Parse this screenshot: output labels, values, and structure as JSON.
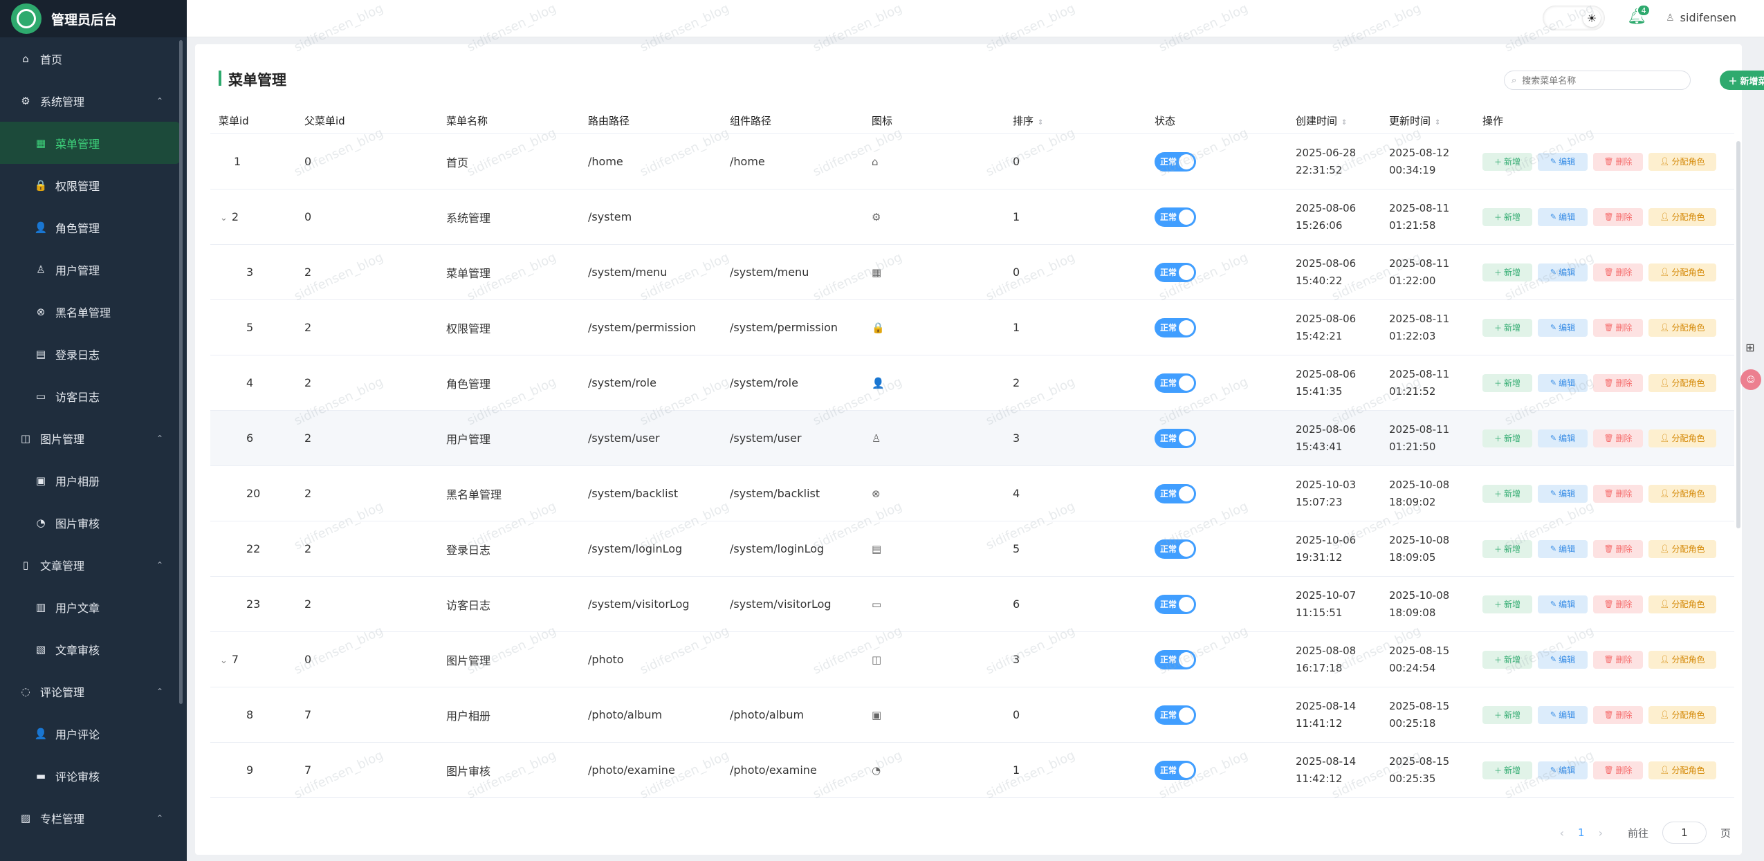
{
  "app": {
    "title": "管理员后台"
  },
  "sidebar": {
    "items": [
      {
        "label": "首页",
        "icon": "home-icon",
        "glyph": "⌂",
        "level": "top",
        "active": false,
        "caret": ""
      },
      {
        "label": "系统管理",
        "icon": "gear-icon",
        "glyph": "⚙",
        "level": "top",
        "active": false,
        "caret": "⌃"
      },
      {
        "label": "菜单管理",
        "icon": "grid-icon",
        "glyph": "▦",
        "level": "sub",
        "active": true,
        "caret": ""
      },
      {
        "label": "权限管理",
        "icon": "lock-icon",
        "glyph": "🔒",
        "level": "sub",
        "active": false,
        "caret": ""
      },
      {
        "label": "角色管理",
        "icon": "user-filled-icon",
        "glyph": "👤",
        "level": "sub",
        "active": false,
        "caret": ""
      },
      {
        "label": "用户管理",
        "icon": "user-icon",
        "glyph": "♙",
        "level": "sub",
        "active": false,
        "caret": ""
      },
      {
        "label": "黑名单管理",
        "icon": "circle-x-icon",
        "glyph": "⊗",
        "level": "sub",
        "active": false,
        "caret": ""
      },
      {
        "label": "登录日志",
        "icon": "calendar-icon",
        "glyph": "▤",
        "level": "sub",
        "active": false,
        "caret": ""
      },
      {
        "label": "访客日志",
        "icon": "monitor-icon",
        "glyph": "▭",
        "level": "sub",
        "active": false,
        "caret": ""
      },
      {
        "label": "图片管理",
        "icon": "camera-icon",
        "glyph": "◫",
        "level": "top",
        "active": false,
        "caret": "⌃"
      },
      {
        "label": "用户相册",
        "icon": "picture-icon",
        "glyph": "▣",
        "level": "sub",
        "active": false,
        "caret": ""
      },
      {
        "label": "图片审核",
        "icon": "check-circle-icon",
        "glyph": "◔",
        "level": "sub",
        "active": false,
        "caret": ""
      },
      {
        "label": "文章管理",
        "icon": "document-icon",
        "glyph": "▯",
        "level": "top",
        "active": false,
        "caret": "⌃"
      },
      {
        "label": "用户文章",
        "icon": "documents-icon",
        "glyph": "▥",
        "level": "sub",
        "active": false,
        "caret": ""
      },
      {
        "label": "文章审核",
        "icon": "document-check-icon",
        "glyph": "▧",
        "level": "sub",
        "active": false,
        "caret": ""
      },
      {
        "label": "评论管理",
        "icon": "chat-icon",
        "glyph": "◌",
        "level": "top",
        "active": false,
        "caret": "⌃"
      },
      {
        "label": "用户评论",
        "icon": "user-filled-icon",
        "glyph": "👤",
        "level": "sub",
        "active": false,
        "caret": ""
      },
      {
        "label": "评论审核",
        "icon": "message-icon",
        "glyph": "▬",
        "level": "sub",
        "active": false,
        "caret": ""
      },
      {
        "label": "专栏管理",
        "icon": "notebook-icon",
        "glyph": "▨",
        "level": "top",
        "active": false,
        "caret": "⌃"
      }
    ]
  },
  "header": {
    "notifications": "4",
    "username": "sidifensen"
  },
  "page": {
    "title": "菜单管理",
    "search_placeholder": "搜索菜单名称",
    "add_label": "新增菜单"
  },
  "table": {
    "headers": [
      "菜单id",
      "父菜单id",
      "菜单名称",
      "路由路径",
      "组件路径",
      "图标",
      "排序",
      "状态",
      "创建时间",
      "更新时间",
      "操作"
    ],
    "status_label": "正常",
    "actions": {
      "add": "新增",
      "edit": "编辑",
      "del": "删除",
      "role": "分配角色"
    },
    "rows": [
      {
        "id": "1",
        "pid": "0",
        "name": "首页",
        "path": "/home",
        "comp": "/home",
        "icon": "⌂",
        "sort": "0",
        "created": [
          "2025-06-28",
          "22:31:52"
        ],
        "updated": [
          "2025-08-12",
          "00:34:19"
        ],
        "expand": false,
        "child": false
      },
      {
        "id": "2",
        "pid": "0",
        "name": "系统管理",
        "path": "/system",
        "comp": "",
        "icon": "⚙",
        "sort": "1",
        "created": [
          "2025-08-06",
          "15:26:06"
        ],
        "updated": [
          "2025-08-11",
          "01:21:58"
        ],
        "expand": true,
        "child": false
      },
      {
        "id": "3",
        "pid": "2",
        "name": "菜单管理",
        "path": "/system/menu",
        "comp": "/system/menu",
        "icon": "▦",
        "sort": "0",
        "created": [
          "2025-08-06",
          "15:40:22"
        ],
        "updated": [
          "2025-08-11",
          "01:22:00"
        ],
        "expand": false,
        "child": true
      },
      {
        "id": "5",
        "pid": "2",
        "name": "权限管理",
        "path": "/system/permission",
        "comp": "/system/permission",
        "icon": "🔒",
        "sort": "1",
        "created": [
          "2025-08-06",
          "15:42:21"
        ],
        "updated": [
          "2025-08-11",
          "01:22:03"
        ],
        "expand": false,
        "child": true
      },
      {
        "id": "4",
        "pid": "2",
        "name": "角色管理",
        "path": "/system/role",
        "comp": "/system/role",
        "icon": "👤",
        "sort": "2",
        "created": [
          "2025-08-06",
          "15:41:35"
        ],
        "updated": [
          "2025-08-11",
          "01:21:52"
        ],
        "expand": false,
        "child": true
      },
      {
        "id": "6",
        "pid": "2",
        "name": "用户管理",
        "path": "/system/user",
        "comp": "/system/user",
        "icon": "♙",
        "sort": "3",
        "created": [
          "2025-08-06",
          "15:43:41"
        ],
        "updated": [
          "2025-08-11",
          "01:21:50"
        ],
        "expand": false,
        "child": true,
        "hl": true
      },
      {
        "id": "20",
        "pid": "2",
        "name": "黑名单管理",
        "path": "/system/backlist",
        "comp": "/system/backlist",
        "icon": "⊗",
        "sort": "4",
        "created": [
          "2025-10-03",
          "15:07:23"
        ],
        "updated": [
          "2025-10-08",
          "18:09:02"
        ],
        "expand": false,
        "child": true
      },
      {
        "id": "22",
        "pid": "2",
        "name": "登录日志",
        "path": "/system/loginLog",
        "comp": "/system/loginLog",
        "icon": "▤",
        "sort": "5",
        "created": [
          "2025-10-06",
          "19:31:12"
        ],
        "updated": [
          "2025-10-08",
          "18:09:05"
        ],
        "expand": false,
        "child": true
      },
      {
        "id": "23",
        "pid": "2",
        "name": "访客日志",
        "path": "/system/visitorLog",
        "comp": "/system/visitorLog",
        "icon": "▭",
        "sort": "6",
        "created": [
          "2025-10-07",
          "11:15:51"
        ],
        "updated": [
          "2025-10-08",
          "18:09:08"
        ],
        "expand": false,
        "child": true
      },
      {
        "id": "7",
        "pid": "0",
        "name": "图片管理",
        "path": "/photo",
        "comp": "",
        "icon": "◫",
        "sort": "3",
        "created": [
          "2025-08-08",
          "16:17:18"
        ],
        "updated": [
          "2025-08-15",
          "00:24:54"
        ],
        "expand": true,
        "child": false
      },
      {
        "id": "8",
        "pid": "7",
        "name": "用户相册",
        "path": "/photo/album",
        "comp": "/photo/album",
        "icon": "▣",
        "sort": "0",
        "created": [
          "2025-08-14",
          "11:41:12"
        ],
        "updated": [
          "2025-08-15",
          "00:25:18"
        ],
        "expand": false,
        "child": true
      },
      {
        "id": "9",
        "pid": "7",
        "name": "图片审核",
        "path": "/photo/examine",
        "comp": "/photo/examine",
        "icon": "◔",
        "sort": "1",
        "created": [
          "2025-08-14",
          "11:42:12"
        ],
        "updated": [
          "2025-08-15",
          "00:25:35"
        ],
        "expand": false,
        "child": true
      }
    ]
  },
  "pagination": {
    "prev": "‹",
    "page": "1",
    "next": "›",
    "goto_label": "前往",
    "goto_value": "1",
    "page_suffix": "页"
  },
  "watermark": "sidifensen_blog"
}
